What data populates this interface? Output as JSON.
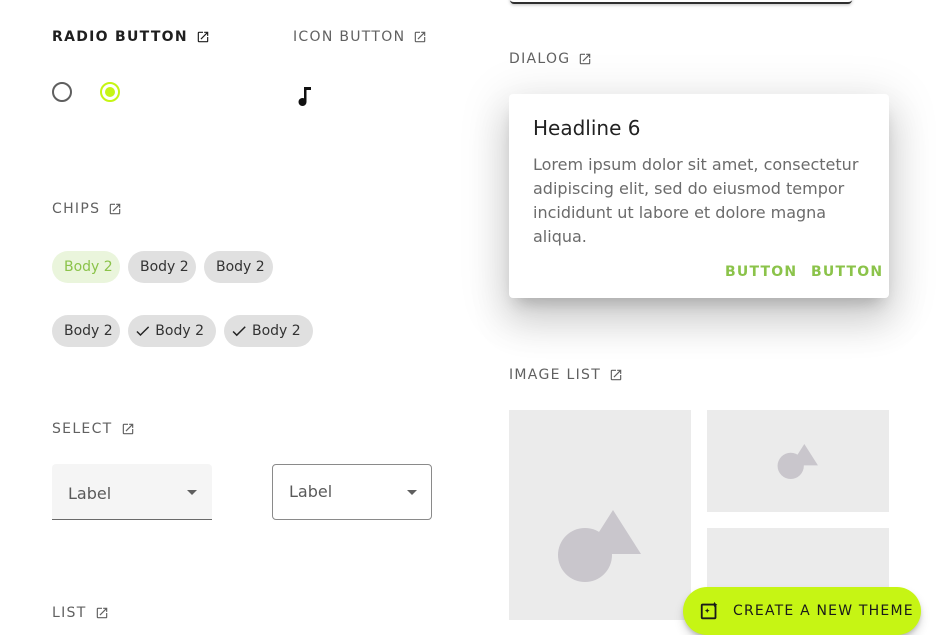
{
  "sections": {
    "radio_button": "RADIO BUTTON",
    "icon_button": "ICON BUTTON",
    "chips": "CHIPS",
    "select": "SELECT",
    "list": "LIST",
    "dialog": "DIALOG",
    "image_list": "IMAGE LIST"
  },
  "radio": {
    "options": [
      {
        "checked": false
      },
      {
        "checked": true
      }
    ]
  },
  "icon_button": {
    "icon": "music-note-icon"
  },
  "chips": {
    "row1": [
      {
        "label": "Body 2",
        "selected": true,
        "checked": false
      },
      {
        "label": "Body 2",
        "selected": false,
        "checked": false
      },
      {
        "label": "Body 2",
        "selected": false,
        "checked": false
      }
    ],
    "row2": [
      {
        "label": "Body 2",
        "selected": false,
        "checked": false
      },
      {
        "label": "Body 2",
        "selected": false,
        "checked": true
      },
      {
        "label": "Body 2",
        "selected": false,
        "checked": true
      }
    ]
  },
  "select": {
    "filled": {
      "label": "Label"
    },
    "outlined": {
      "label": "Label"
    }
  },
  "dialog": {
    "headline": "Headline 6",
    "body": "Lorem ipsum dolor sit amet, consectetur adipiscing elit, sed do eiusmod tempor incididunt ut labore et dolore magna aliqua.",
    "buttons": [
      "BUTTON",
      "BUTTON"
    ]
  },
  "fab": {
    "label": "CREATE A NEW THEME",
    "icon": "palette-sparkle-icon"
  },
  "colors": {
    "accent": "#c6f514",
    "primary_text": "#8bc34a",
    "chip_bg": "#e0e0e0",
    "chip_selected_bg": "#eaf5dc"
  }
}
